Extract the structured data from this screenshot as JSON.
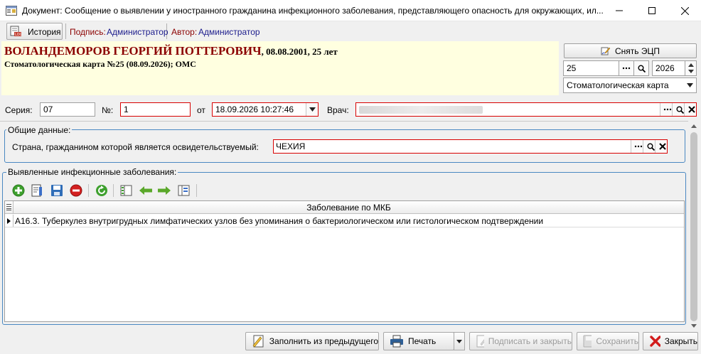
{
  "window": {
    "title": "Документ: Сообщение о выявлении у иностранного гражданина инфекционного заболевания, представляющего опасность для окружающих, ил...",
    "minimize_glyph": "—",
    "maximize_glyph": "☐",
    "close_glyph": "✕"
  },
  "toolbar": {
    "history_label": "История",
    "sign_label": "Подпись:",
    "sign_value": "Администратор",
    "author_label": "Автор:",
    "author_value": "Администратор"
  },
  "patient": {
    "name": "ВОЛАНДЕМОРОВ ГЕОРГИЙ ПОТТЕРОВИЧ",
    "dob": ", 08.08.2001, 25 лет",
    "card": "Стоматологическая карта №25 (08.09.2026); ОМС"
  },
  "right_panel": {
    "sign_ecp_label": "Снять ЭЦП",
    "card_number": "25",
    "card_year": "2026",
    "card_type": "Стоматологическая карта"
  },
  "document": {
    "series_label": "Серия:",
    "series_value": "07",
    "number_label": "№:",
    "number_value": "1",
    "date_label": "от",
    "date_value": "18.09.2026 10:27:46",
    "doctor_label": "Врач:",
    "doctor_value": ""
  },
  "general": {
    "group_title": "Общие данные:",
    "country_label": "Страна, гражданином которой является освидетельствуемый:",
    "country_value": "ЧЕХИЯ"
  },
  "diseases": {
    "group_title": "Выявленные инфекционные заболевания:",
    "column_header": "Заболевание по МКБ",
    "rows": [
      "A16.3. Туберкулез внутригрудных лимфатических узлов без упоминания о бактериологическом или гистологическом подтверждении"
    ]
  },
  "buttons": {
    "fill_prev": "Заполнить из предыдущего",
    "print": "Печать",
    "sign_close": "Подписать и закрыть",
    "save": "Сохранить",
    "close": "Закрыть"
  },
  "colors": {
    "required_border": "#d80000",
    "patient_bg": "#ffffe0",
    "patient_name": "#8b0000",
    "group_border": "#4a88c2"
  }
}
